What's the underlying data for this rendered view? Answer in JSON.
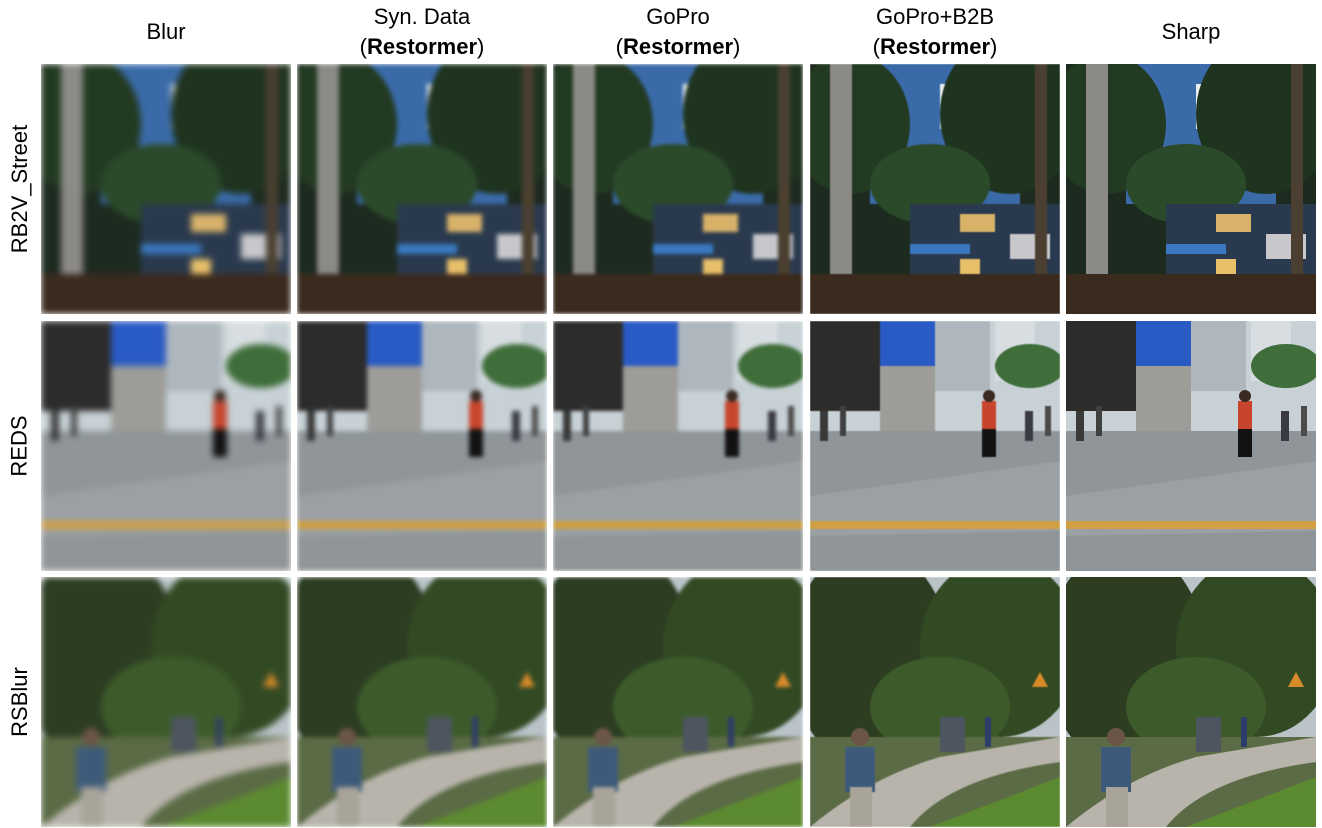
{
  "columns": [
    {
      "line1": "Blur",
      "line2": "",
      "line2_bold": ""
    },
    {
      "line1": "Syn. Data",
      "line2": "(",
      "line2_bold": "Restormer",
      "line2_end": ")"
    },
    {
      "line1": "GoPro",
      "line2": "(",
      "line2_bold": "Restormer",
      "line2_end": ")"
    },
    {
      "line1": "GoPro+B2B",
      "line2": "(",
      "line2_bold": "Restormer",
      "line2_end": ")"
    },
    {
      "line1": "Sharp",
      "line2": "",
      "line2_bold": ""
    }
  ],
  "rows": [
    {
      "label": "RB2V_Street"
    },
    {
      "label": "REDS"
    },
    {
      "label": "RSBlur"
    }
  ]
}
